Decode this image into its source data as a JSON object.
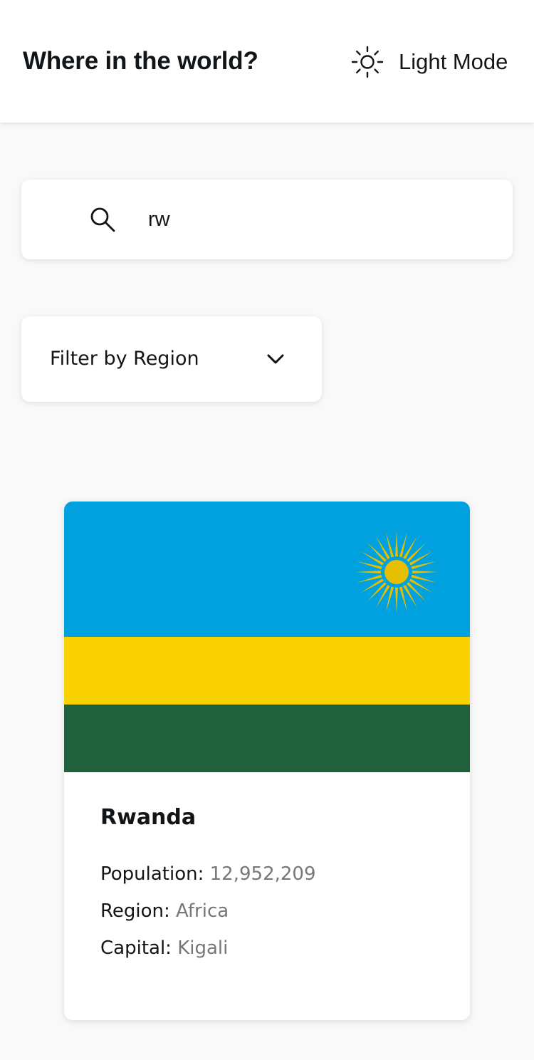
{
  "header": {
    "title": "Where in the world?",
    "mode_toggle": {
      "icon": "sun-icon",
      "label": "Light Mode"
    }
  },
  "search": {
    "icon": "search-icon",
    "value": "rw"
  },
  "filter": {
    "label": "Filter by Region",
    "icon": "chevron-down-icon"
  },
  "countries": [
    {
      "name": "Rwanda",
      "flag": "rwanda-flag",
      "population_label": "Population:",
      "population": "12,952,209",
      "region_label": "Region:",
      "region": "Africa",
      "capital_label": "Capital:",
      "capital": "Kigali"
    }
  ],
  "colors": {
    "background": "#f9f9f9",
    "surface": "#ffffff",
    "text": "#111517",
    "muted": "#777777",
    "flag_blue": "#00a1de",
    "flag_yellow": "#fad201",
    "flag_green": "#20603d",
    "flag_sun": "#e5be01"
  }
}
